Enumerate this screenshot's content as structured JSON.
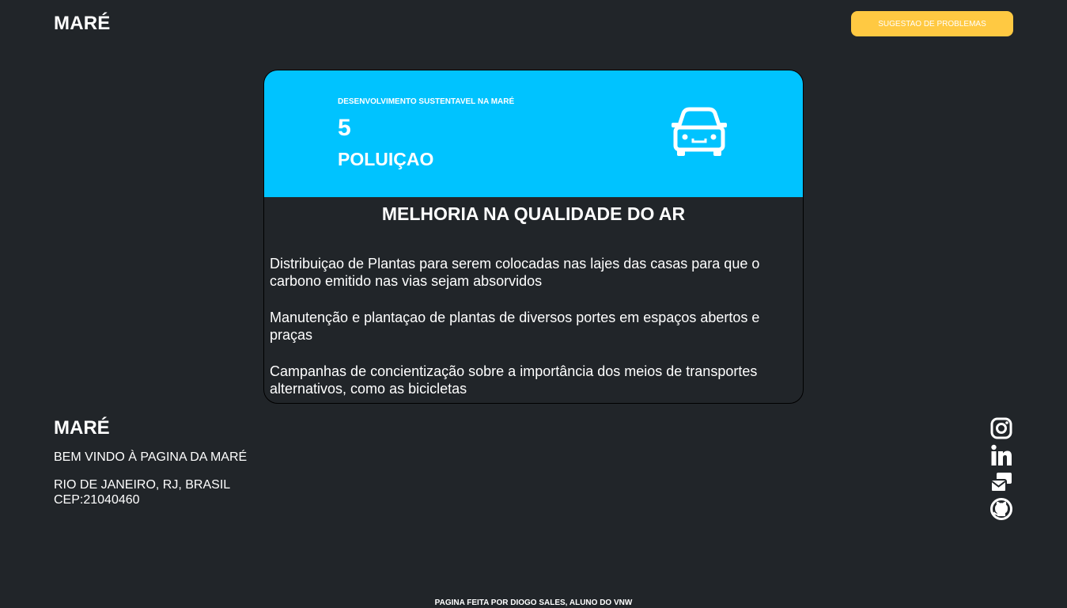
{
  "header": {
    "brand": "MARÉ",
    "suggest_button": "SUGESTAO DE PROBLEMAS"
  },
  "card": {
    "subtitle": "DESENVOLVIMENTO SUSTENTAVEL NA MARÉ",
    "number": "5",
    "title": "POLUIÇAO",
    "icon": "car-icon",
    "heading": "MELHORIA NA QUALIDADE DO AR",
    "items": [
      "Distribuiçao de Plantas para serem colocadas nas lajes das casas para que o carbono emitido nas vias sejam absorvidos",
      "Manutenção e plantaçao de plantas de diversos portes em espaços abertos e praças",
      "Campanhas de concientização sobre a importância dos meios de transportes alternativos, como as bicicletas"
    ]
  },
  "footer": {
    "brand": "MARÉ",
    "welcome": "BEM VINDO À PAGINA DA MARÉ",
    "address_line1": "RIO DE JANEIRO, RJ, BRASIL",
    "address_line2": "CEP:21040460",
    "socials": [
      "instagram-icon",
      "linkedin-icon",
      "mail-icon",
      "github-icon"
    ],
    "credit": "PAGINA FEITA POR DIOGO SALES, ALUNO DO VNW"
  },
  "colors": {
    "background": "#212529",
    "accent_yellow": "#ffc942",
    "card_blue": "#00c3ff",
    "text": "#ffffff"
  }
}
